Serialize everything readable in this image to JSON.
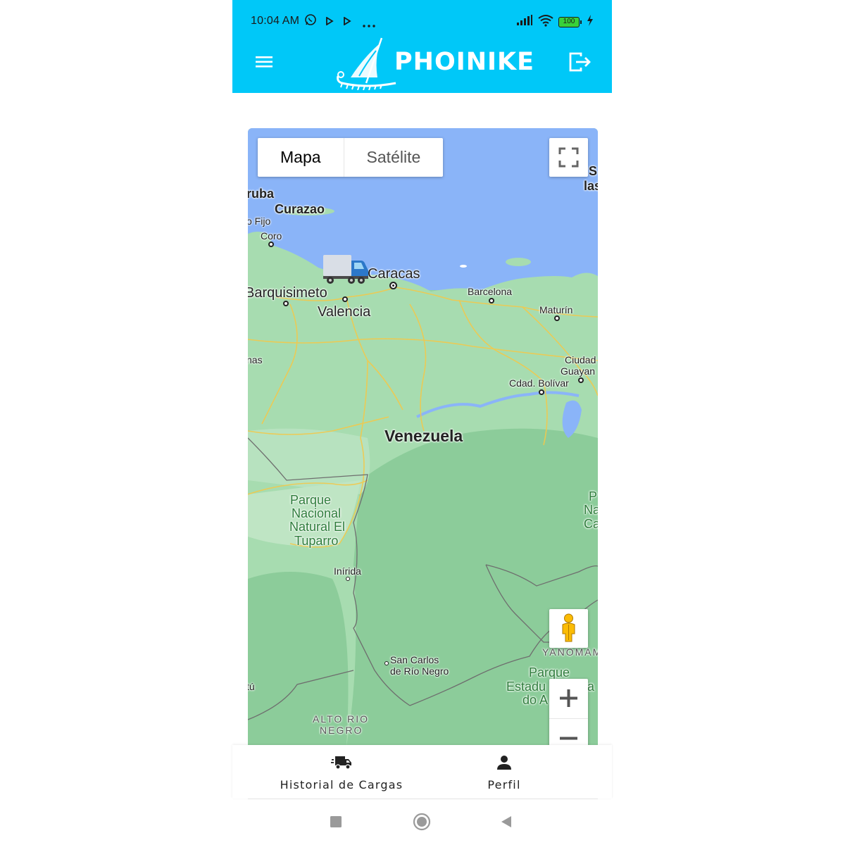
{
  "status_bar": {
    "time": "10:04 AM",
    "battery": "100",
    "icons": [
      "whatsapp-icon",
      "play-icon",
      "play-icon",
      "more-dots-icon",
      "signal-icon",
      "wifi-icon",
      "battery-icon",
      "charging-icon"
    ]
  },
  "app_bar": {
    "brand": "PHOINIKE",
    "menu_icon": "hamburger-menu-icon",
    "logout_icon": "logout-icon",
    "background_color": "#00c8f8"
  },
  "map": {
    "map_type": {
      "map_label": "Mapa",
      "satellite_label": "Satélite",
      "selected": "Mapa"
    },
    "controls": [
      "fullscreen-icon",
      "pegman-icon",
      "zoom-in-icon",
      "zoom-out-icon"
    ],
    "labels": {
      "aruba": "ruba",
      "curazao": "Curazao",
      "fijo": "o Fijo",
      "coro": "Coro",
      "caracas": "Caracas",
      "barquisimeto": "Barquisimeto",
      "valencia": "Valencia",
      "barcelona": "Barcelona",
      "maturin": "Maturín",
      "nas": "nas",
      "ciudad_guayana_1": "Ciudad",
      "ciudad_guayana_2": "Guayan",
      "cdad_bolivar": "Cdad. Bolívar",
      "venezuela": "Venezuela",
      "parque_tuparro_1": "Parque",
      "parque_tuparro_2": "Nacional",
      "parque_tuparro_3": "Natural El",
      "parque_tuparro_4": "Tuparro",
      "inirida": "Inírida",
      "san_carlos_1": "San Carlos",
      "san_carlos_2": "de Río Negro",
      "alto_rio_1": "ALTO RIO",
      "alto_rio_2": "NEGRO",
      "yanomami": "YANOMAM",
      "parque_estadual_1": "Parque",
      "parque_estadual_2": "Estadu",
      "parque_estadual_3": "do A",
      "edge_s": "S",
      "edge_las": "las",
      "edge_p": "P",
      "edge_na": "Na",
      "edge_ca": "Ca",
      "edge_a": "a",
      "edge_tu": "tú"
    },
    "marker": "truck-marker-icon"
  },
  "bottom_nav": {
    "items": [
      {
        "label": "Historial de Cargas",
        "icon": "truck-icon"
      },
      {
        "label": "Perfil",
        "icon": "person-icon"
      }
    ]
  },
  "system_nav": [
    "square-recents-icon",
    "circle-home-icon",
    "triangle-back-icon"
  ]
}
